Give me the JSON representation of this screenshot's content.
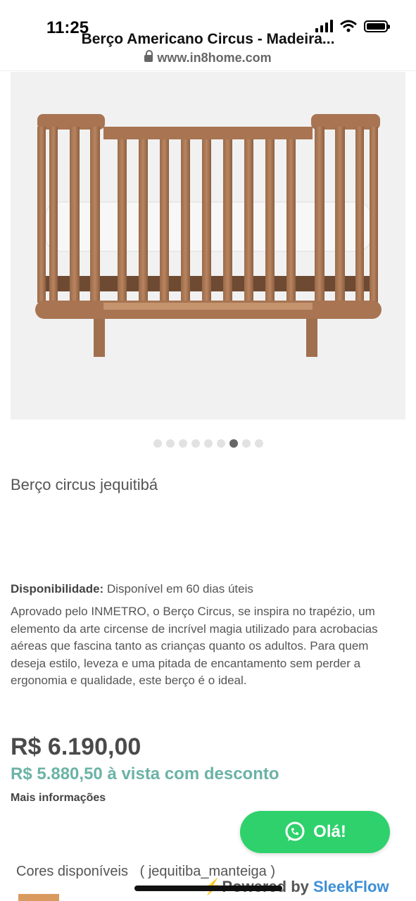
{
  "status_bar": {
    "time": "11:25"
  },
  "browser": {
    "page_title": "Berço Americano Circus - Madeira...",
    "url": "www.in8home.com"
  },
  "gallery": {
    "dot_count": 9,
    "active_index": 6
  },
  "product": {
    "name": "Berço circus jequitibá",
    "availability_label": "Disponibilidade:",
    "availability_value": "Disponível em 60 dias úteis",
    "description": "Aprovado pelo INMETRO, o Berço Circus, se inspira no trapézio, um elemento da arte circense de incrível magia utilizado para acrobacias aéreas que fascina tanto as crianças quanto os adultos. Para quem deseja estilo, leveza e uma pitada de encantamento sem perder a ergonomia e qualidade, este berço é o ideal.",
    "price": "R$ 6.190,00",
    "cash_price": "R$ 5.880,50 à vista com desconto",
    "more_info": "Mais informações",
    "colors_label": "Cores disponíveis",
    "colors_value": "( jequitiba_manteiga )"
  },
  "chat_widget": {
    "button_label": "Olá!",
    "powered_prefix": "Powered by ",
    "powered_brand": "SleekFlow"
  }
}
